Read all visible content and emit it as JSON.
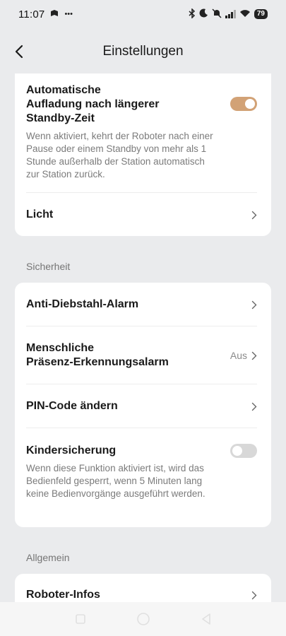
{
  "status_bar": {
    "time": "11:07",
    "extra_icons": "•••",
    "battery": "79"
  },
  "header": {
    "title": "Einstellungen"
  },
  "card1": {
    "auto_recharge": {
      "title_line1": "Automatische",
      "title_line2": "Aufladung nach längerer",
      "title_line3": "Standby-Zeit",
      "description": "Wenn aktiviert, kehrt der Roboter nach einer Pause oder einem Standby von mehr als 1 Stunde außerhalb der Station automatisch zur Station zurück.",
      "enabled": true
    },
    "light": {
      "title": "Licht"
    }
  },
  "sections": {
    "security": "Sicherheit",
    "general": "Allgemein"
  },
  "card2": {
    "anti_theft": {
      "title": "Anti-Diebstahl-Alarm"
    },
    "presence": {
      "title_line1": "Menschliche",
      "title_line2": "Präsenz-Erkennungsalarm",
      "value": "Aus"
    },
    "pin": {
      "title": "PIN-Code ändern"
    },
    "child_lock": {
      "title": "Kindersicherung",
      "description": "Wenn diese Funktion aktiviert ist, wird das Bedienfeld gesperrt, wenn 5 Minuten lang keine Bedienvorgänge ausgeführt werden.",
      "enabled": false
    }
  },
  "card3": {
    "robot_info": {
      "title": "Roboter-Infos"
    }
  },
  "colors": {
    "toggle_on": "#d2a276",
    "toggle_off": "#d8d8d8",
    "background": "#eaebed"
  }
}
